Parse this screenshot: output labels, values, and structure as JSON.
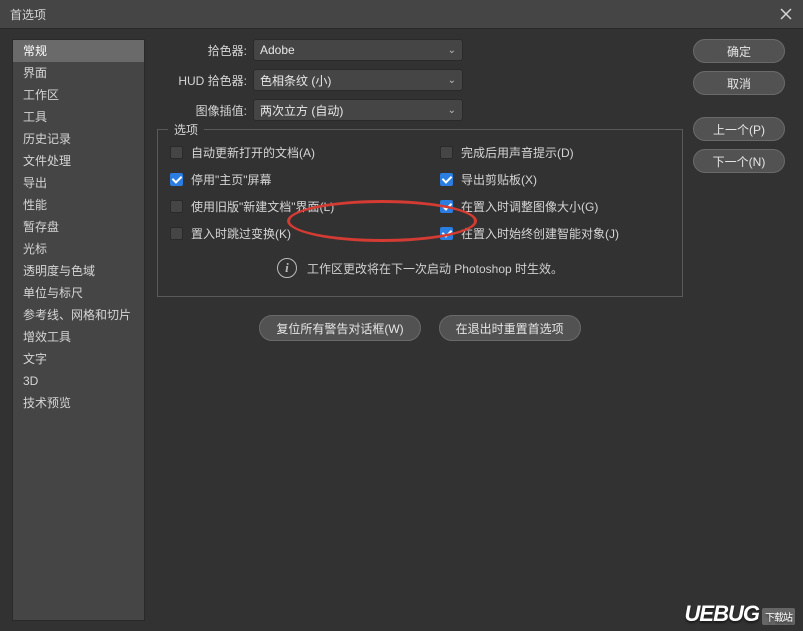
{
  "title": "首选项",
  "sidebar": {
    "items": [
      "常规",
      "界面",
      "工作区",
      "工具",
      "历史记录",
      "文件处理",
      "导出",
      "性能",
      "暂存盘",
      "光标",
      "透明度与色域",
      "单位与标尺",
      "参考线、网格和切片",
      "增效工具",
      "文字",
      "3D",
      "技术预览"
    ],
    "selected_index": 0
  },
  "dropdowns": {
    "picker_label": "拾色器:",
    "picker_value": "Adobe",
    "hud_label": "HUD 拾色器:",
    "hud_value": "色相条纹 (小)",
    "interp_label": "图像插值:",
    "interp_value": "两次立方 (自动)"
  },
  "options": {
    "legend": "选项",
    "left": [
      {
        "label": "自动更新打开的文档(A)",
        "checked": false
      },
      {
        "label": "停用\"主页\"屏幕",
        "checked": true
      },
      {
        "label": "使用旧版\"新建文档\"界面(L)",
        "checked": false
      },
      {
        "label": "置入时跳过变换(K)",
        "checked": false
      }
    ],
    "right": [
      {
        "label": "完成后用声音提示(D)",
        "checked": false
      },
      {
        "label": "导出剪贴板(X)",
        "checked": true
      },
      {
        "label": "在置入时调整图像大小(G)",
        "checked": true
      },
      {
        "label": "在置入时始终创建智能对象(J)",
        "checked": true
      }
    ],
    "info_text": "工作区更改将在下一次启动 Photoshop 时生效。"
  },
  "under_buttons": {
    "reset_dialogs": "复位所有警告对话框(W)",
    "reset_on_quit": "在退出时重置首选项"
  },
  "dialog_buttons": {
    "ok": "确定",
    "cancel": "取消",
    "prev": "上一个(P)",
    "next": "下一个(N)"
  },
  "watermark": {
    "logo": "UEBUG",
    "cn": "下载站"
  }
}
